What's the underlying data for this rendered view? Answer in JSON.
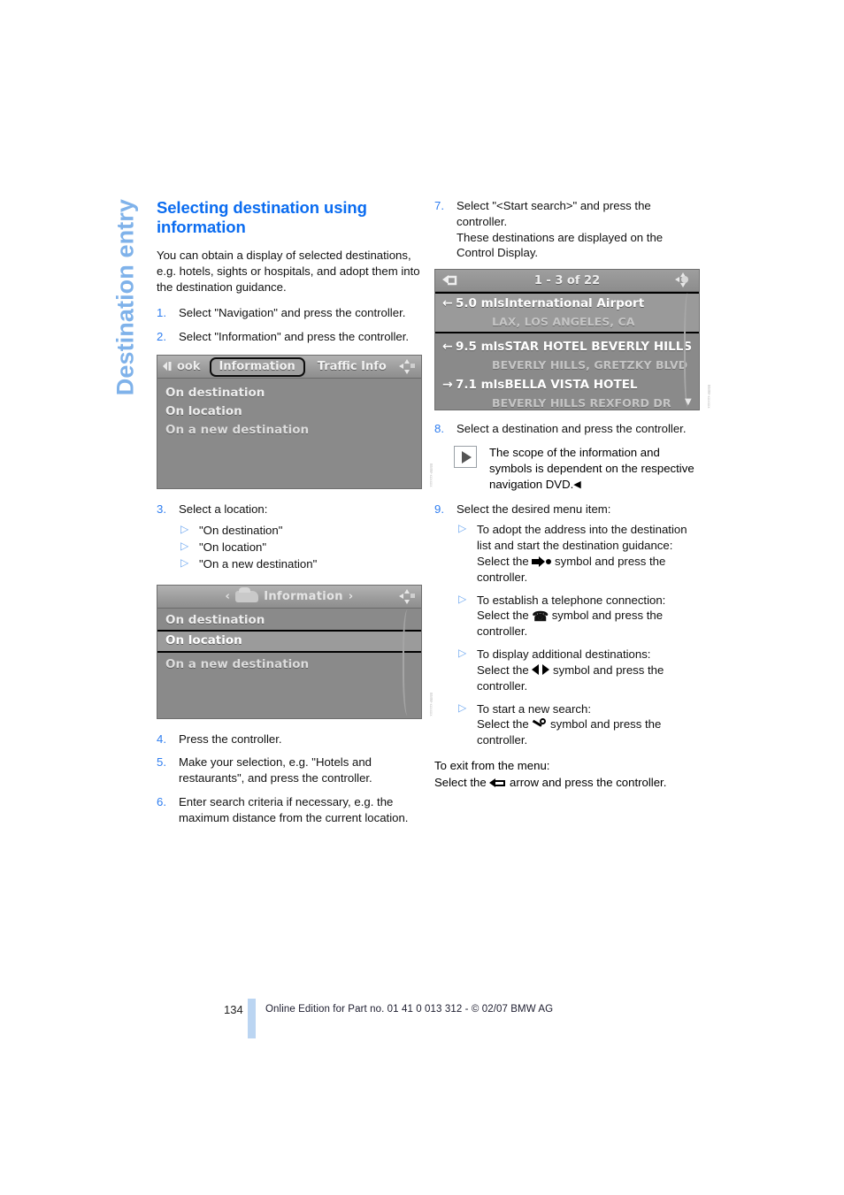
{
  "chapter_tab": "Destination entry",
  "left": {
    "title": "Selecting destination using information",
    "intro": "You can obtain a display of selected destinations, e.g. hotels, sights or hospitals, and adopt them into the destination guidance.",
    "steps": [
      {
        "num": "1.",
        "text": "Select \"Navigation\" and press the controller."
      },
      {
        "num": "2.",
        "text": "Select \"Information\" and press the controller."
      }
    ],
    "step3": {
      "num": "3.",
      "text": "Select a location:"
    },
    "step3_bullets": [
      "\"On destination\"",
      "\"On location\"",
      "\"On a new destination\""
    ],
    "steps_tail": [
      {
        "num": "4.",
        "text": "Press the controller."
      },
      {
        "num": "5.",
        "text": "Make your selection, e.g. \"Hotels and restaurants\", and press the controller."
      },
      {
        "num": "6.",
        "text": "Enter search criteria if necessary, e.g. the maximum distance from the current location."
      }
    ]
  },
  "right": {
    "step7": {
      "num": "7.",
      "text": "Select \"<Start search>\" and press the controller.\nThese destinations are displayed on the Control Display."
    },
    "step8": {
      "num": "8.",
      "text": "Select a destination and press the controller."
    },
    "note": "The scope of the information and symbols is dependent on the respective navigation DVD.",
    "step9": {
      "num": "9.",
      "text": "Select the desired menu item:"
    },
    "menu_items": [
      {
        "line1": "To adopt the address into the destination list and start the destination guidance:",
        "prefix": "Select the",
        "symbol": "arrow-to-dot-icon",
        "suffix": "symbol and press the controller."
      },
      {
        "line1": "To establish a telephone connection:",
        "prefix": "Select the",
        "symbol": "telephone-handset-icon",
        "suffix": "symbol and press the controller."
      },
      {
        "line1": "To display additional destinations:",
        "prefix": "Select the",
        "symbol": "left-right-arrows-icon",
        "suffix": "symbol and press the controller."
      },
      {
        "line1": "To start a new search:",
        "prefix": "Select the",
        "symbol": "magnifier-key-icon",
        "suffix": "symbol and press the controller."
      }
    ],
    "exit_line1": "To exit from the menu:",
    "exit_prefix": "Select the",
    "exit_symbol": "back-arrow-icon",
    "exit_suffix": "arrow and press the controller."
  },
  "screenshot_information_tabs": {
    "tab_left": "ook",
    "tab_selected": "Information",
    "tab_right": "Traffic Info",
    "rows": [
      "On destination",
      "On location",
      "On a new destination"
    ]
  },
  "screenshot_information_menu": {
    "header": "Information",
    "header_left_caret": "‹",
    "header_right_caret": "›",
    "rows": [
      "On destination",
      "On location",
      "On a new destination"
    ],
    "selected_row": "On location"
  },
  "screenshot_destination_list": {
    "counter": "1 - 3 of 22",
    "entries": [
      {
        "arrow": "←",
        "distance": "5.0  mls",
        "name": "International Airport",
        "address": "LAX, LOS ANGELES, CA",
        "selected": true
      },
      {
        "arrow": "←",
        "distance": "9.5  mls",
        "name": "STAR HOTEL BEVERLY HILLS",
        "address": "BEVERLY HILLS, GRETZKY BLVD",
        "selected": false
      },
      {
        "arrow": "→",
        "distance": "7.1  mls",
        "name": "BELLA VISTA HOTEL",
        "address": "BEVERLY HILLS REXFORD DR",
        "selected": false
      }
    ]
  },
  "footer": {
    "page_number": "134",
    "text": "Online Edition for Part no. 01 41 0 013 312 - © 02/07 BMW AG"
  },
  "colors": {
    "heading_blue": "#0B6CF0",
    "tab_blue": "#7FB2EA",
    "bullet_blue": "#6FA8F0",
    "footer_rule": "#BBD5F2"
  }
}
